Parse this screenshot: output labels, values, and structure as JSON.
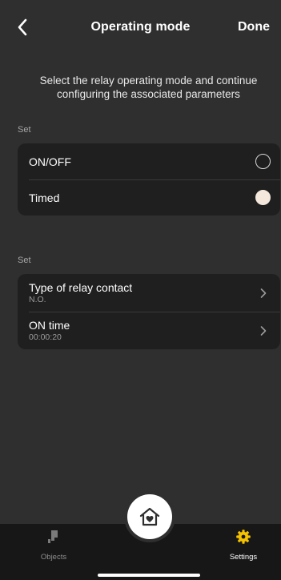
{
  "header": {
    "title": "Operating mode",
    "done_label": "Done",
    "back_icon": "chevron-left-icon"
  },
  "intro": "Select the relay operating mode and continue configuring the associated parameters",
  "sections": [
    {
      "label": "Set",
      "options": [
        {
          "label": "ON/OFF",
          "selected": false
        },
        {
          "label": "Timed",
          "selected": true
        }
      ]
    },
    {
      "label": "Set",
      "rows": [
        {
          "label": "Type of relay contact",
          "value": "N.O."
        },
        {
          "label": "ON time",
          "value": "00:00:20"
        }
      ]
    }
  ],
  "tabbar": {
    "objects_label": "Objects",
    "settings_label": "Settings",
    "home_icon": "home-heart-icon"
  },
  "colors": {
    "background": "#2f2f2f",
    "card": "#1f1f1f",
    "tabbar": "#171717",
    "accent": "#f5c200",
    "radio_selected": "#f4e8dc"
  }
}
